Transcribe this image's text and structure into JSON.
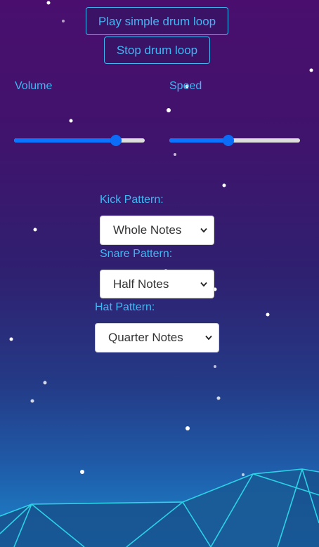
{
  "buttons": {
    "play_label": "Play simple drum loop",
    "stop_label": "Stop drum loop"
  },
  "controls": {
    "volume_label": "Volume",
    "volume_level": 0.78,
    "speed_label": "Speed",
    "speed_level": 0.45
  },
  "patterns": {
    "kick_label": "Kick Pattern:",
    "kick_value": "Whole Notes",
    "snare_label": "Snare Pattern:",
    "snare_value": "Half Notes",
    "hat_label": "Hat Pattern:",
    "hat_value": "Quarter Notes"
  },
  "colors": {
    "accent": "#41b8f4",
    "button_bg": "#3a1367",
    "slider_fill": "#0b75ff",
    "bg_top": "#4a0f6e",
    "bg_bottom": "#1c86cc",
    "mesh": "#2ee0f0"
  },
  "icons": {
    "select_arrow": "chevron-down-icon"
  }
}
